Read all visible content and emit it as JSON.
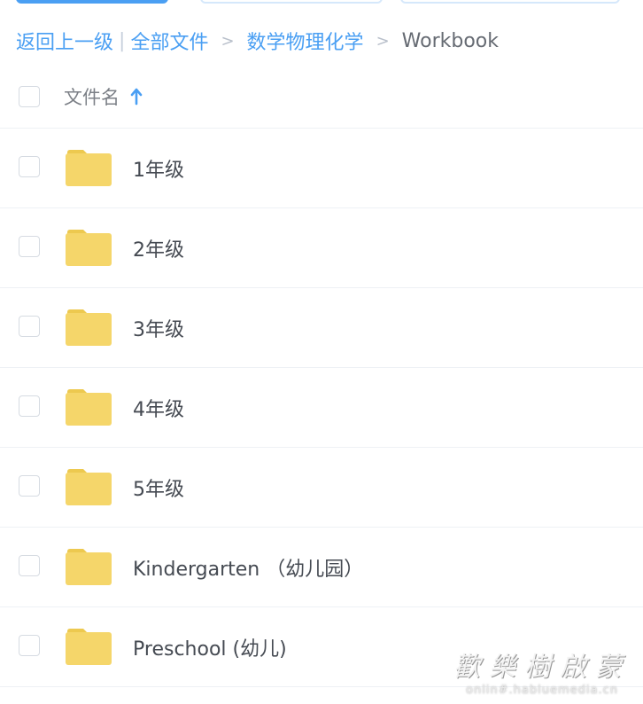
{
  "breadcrumb": {
    "back": "返回上一级",
    "separator": "|",
    "root": "全部文件",
    "arrow": ">",
    "parent": "数学物理化学",
    "current": "Workbook"
  },
  "header": {
    "column_label": "文件名",
    "sort_icon": "arrow-up-icon"
  },
  "files": [
    {
      "name": "1年级",
      "icon": "folder-icon"
    },
    {
      "name": "2年级",
      "icon": "folder-icon"
    },
    {
      "name": "3年级",
      "icon": "folder-icon"
    },
    {
      "name": "4年级",
      "icon": "folder-icon"
    },
    {
      "name": "5年级",
      "icon": "folder-icon"
    },
    {
      "name": "Kindergarten （幼儿园）",
      "icon": "folder-icon"
    },
    {
      "name": "Preschool (幼儿)",
      "icon": "folder-icon"
    }
  ],
  "watermark": {
    "main": "歡樂樹啟蒙",
    "url": "onlin#.habluemedia.cn"
  },
  "colors": {
    "accent": "#4a9ff3",
    "folder": "#f5d66a",
    "folder_tab": "#edc94f"
  }
}
